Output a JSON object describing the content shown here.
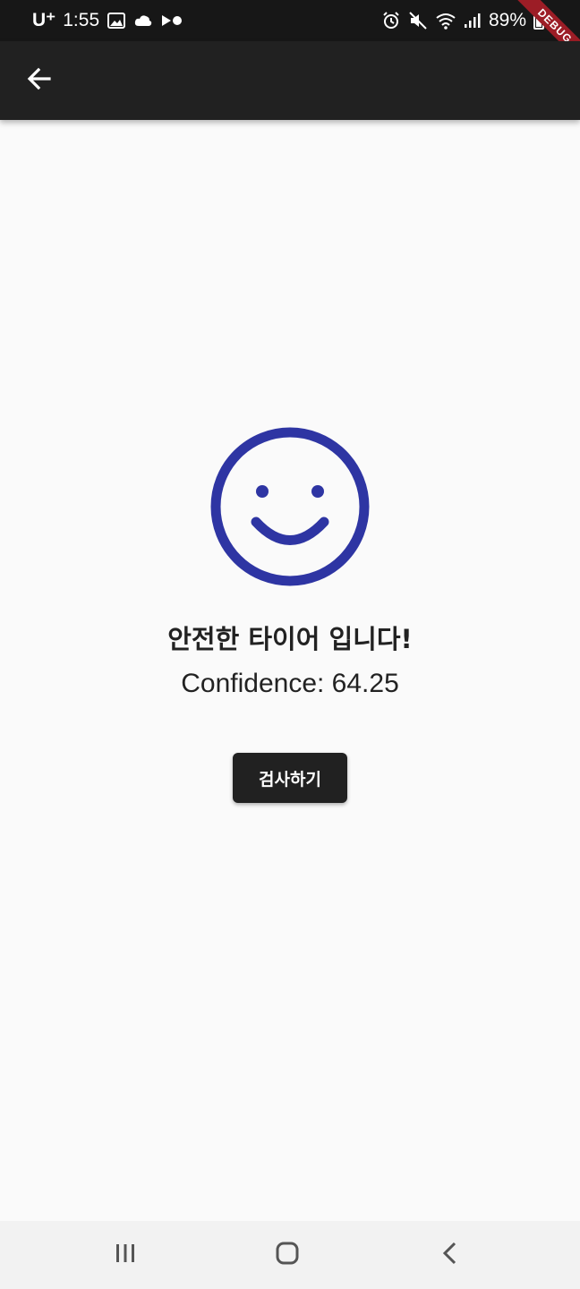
{
  "status_bar": {
    "carrier": "U⁺",
    "time": "1:55",
    "battery": "89%",
    "left_icons": [
      "image-icon",
      "cloud-icon",
      "media-icon"
    ],
    "right_icons": [
      "alarm-icon",
      "mute-icon",
      "wifi-icon",
      "signal-icon",
      "battery-icon"
    ]
  },
  "debug_banner": {
    "label": "DEBUG",
    "color": "#9c1d26"
  },
  "app_bar": {
    "back_icon": "arrow-back-icon",
    "background": "#212121"
  },
  "result": {
    "icon": "smiley-face-icon",
    "icon_color": "#2e35a3",
    "title": "안전한 타이어 입니다!",
    "confidence": "Confidence: 64.25"
  },
  "actions": {
    "inspect_label": "검사하기"
  },
  "nav_bar": {
    "icons": [
      "recent-apps-icon",
      "home-icon",
      "back-icon"
    ]
  }
}
